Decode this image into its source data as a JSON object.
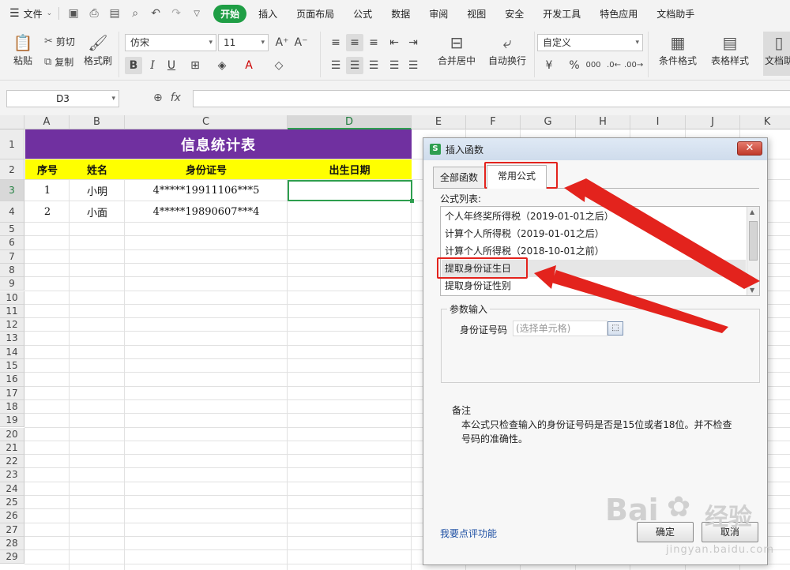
{
  "menubar": {
    "file": "文件",
    "tabs": [
      "开始",
      "插入",
      "页面布局",
      "公式",
      "数据",
      "审阅",
      "视图",
      "安全",
      "开发工具",
      "特色应用",
      "文档助手"
    ],
    "active_tab": "开始"
  },
  "ribbon": {
    "paste": "粘贴",
    "cut": "剪切",
    "copy": "复制",
    "format_painter": "格式刷",
    "font_name": "仿宋",
    "font_size": "11",
    "merge_center": "合并居中",
    "wrap_text": "自动换行",
    "number_format": "自定义",
    "conditional_format": "条件格式",
    "table_style": "表格样式",
    "doc_assistant": "文档助",
    "bold": "B",
    "italic": "I",
    "underline": "U",
    "percent": "%",
    "thousands": "000"
  },
  "formula_bar": {
    "name_box": "D3",
    "fx": "fx",
    "value": ""
  },
  "grid": {
    "columns": [
      "A",
      "B",
      "C",
      "D",
      "E",
      "F",
      "G",
      "H",
      "I",
      "J",
      "K"
    ],
    "selected_column": "D",
    "rows": [
      "1",
      "2",
      "3",
      "4",
      "5",
      "6",
      "7",
      "8",
      "9",
      "10",
      "11",
      "12",
      "13",
      "14",
      "15",
      "16",
      "17",
      "18",
      "19",
      "20",
      "21",
      "22",
      "23",
      "24",
      "25",
      "26",
      "27",
      "28",
      "29"
    ],
    "selected_row": "3",
    "title": "信息统计表",
    "headers": [
      "序号",
      "姓名",
      "身份证号",
      "出生日期"
    ],
    "data": [
      [
        "1",
        "小明",
        "4*****19911106***5",
        ""
      ],
      [
        "2",
        "小面",
        "4*****19890607***4",
        ""
      ]
    ]
  },
  "dialog": {
    "title": "插入函数",
    "tabs": [
      "全部函数",
      "常用公式"
    ],
    "active_tab": "常用公式",
    "list_label": "公式列表:",
    "formulas": [
      "个人年终奖所得税（2019-01-01之后）",
      "计算个人所得税（2019-01-01之后）",
      "计算个人所得税（2018-10-01之前）",
      "提取身份证生日",
      "提取身份证性别"
    ],
    "selected_formula": "提取身份证生日",
    "params_legend": "参数输入",
    "param_label": "身份证号码",
    "param_placeholder": "(选择单元格)",
    "notes_title": "备注",
    "notes_text": "本公式只检查输入的身份证号码是否是15位或者18位。并不检查号码的准确性。",
    "feedback_link": "我要点评功能",
    "ok": "确定",
    "cancel": "取消"
  },
  "watermark": {
    "brand": "Bai",
    "brand_cn": "经验",
    "url": "jingyan.baidu.com"
  },
  "colors": {
    "accent": "#1f9e45",
    "title_band": "#7030a0",
    "header_band": "#ffff00",
    "annotation": "#e3231d"
  }
}
